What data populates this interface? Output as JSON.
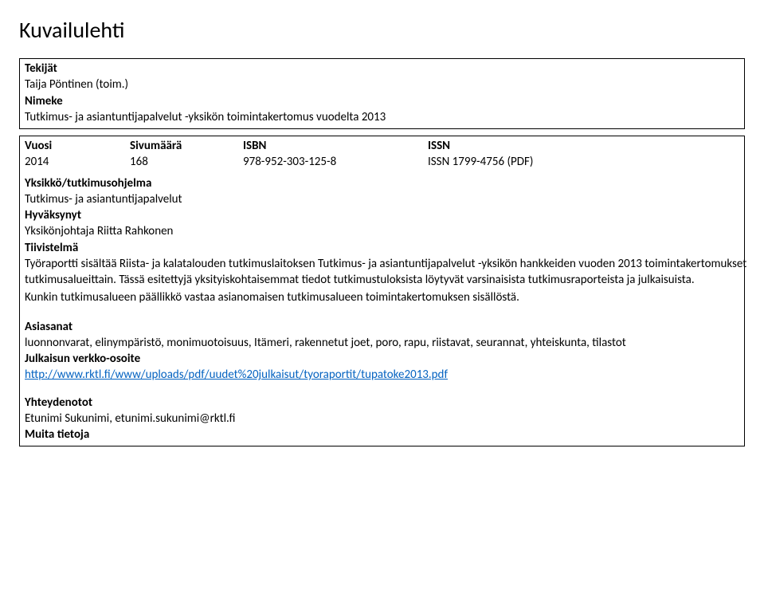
{
  "title": "Kuvailulehti",
  "block1": {
    "tekijat_label": "Tekijät",
    "tekijat_value": "Taija Pöntinen (toim.)",
    "nimeke_label": "Nimeke",
    "nimeke_value": "Tutkimus- ja asiantuntijapalvelut -yksikön toimintakertomus vuodelta 2013"
  },
  "block2": {
    "vuosi_label": "Vuosi",
    "vuosi_value": "2014",
    "sivumaara_label": "Sivumäärä",
    "sivumaara_value": "168",
    "isbn_label": "ISBN",
    "isbn_value": "978-952-303-125-8",
    "issn_label": "ISSN",
    "issn_value": "ISSN 1799-4756 (PDF)",
    "yksikko_label": "Yksikkö/tutkimusohjelma",
    "yksikko_value": "Tutkimus- ja asiantuntijapalvelut",
    "hyvaksynyt_label": "Hyväksynyt",
    "hyvaksynyt_value": "Yksikönjohtaja Riitta Rahkonen",
    "tiivistelma_label": "Tiivistelmä",
    "tiivistelma_p1": "Työraportti sisältää Riista- ja kalatalouden tutkimuslaitoksen Tutkimus- ja asiantuntijapalvelut -yksikön hankkeiden vuoden 2013 toimintakertomukset tutkimusalueittain. Tässä esitettyjä yksityiskohtaisemmat tiedot tutkimustuloksista löytyvät varsinaisista tutkimusraporteista ja julkaisuista.",
    "tiivistelma_p2": "Kunkin tutkimusalueen päällikkö vastaa asianomaisen tutkimusalueen toimintakertomuksen sisällöstä.",
    "asiasanat_label": "Asiasanat",
    "asiasanat_value": "luonnonvarat, elinympäristö, monimuotoisuus, Itämeri, rakennetut joet, poro, rapu, riistavat, seurannat, yhteiskunta, tilastot",
    "julkaisun_label": "Julkaisun verkko-osoite",
    "julkaisun_url": "http://www.rktl.fi/www/uploads/pdf/uudet%20julkaisut/tyoraportit/tupatoke2013.pdf",
    "yhteydenotot_label": "Yhteydenotot",
    "yhteydenotot_value": "Etunimi Sukunimi, etunimi.sukunimi@rktl.fi",
    "muita_label": "Muita tietoja"
  }
}
